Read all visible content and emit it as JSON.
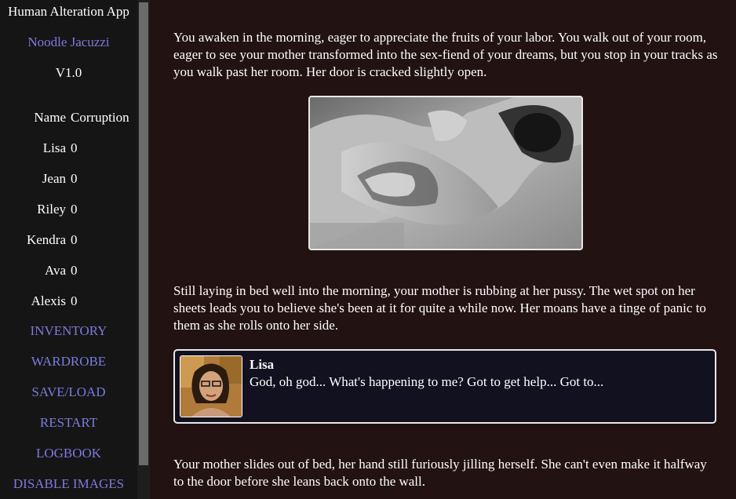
{
  "sidebar": {
    "app_title": "Human Alteration App",
    "author": "Noodle Jacuzzi",
    "version": "V1.0",
    "table_header": {
      "name": "Name",
      "corruption": "Corruption"
    },
    "characters": [
      {
        "name": "Lisa",
        "corruption": "0"
      },
      {
        "name": "Jean",
        "corruption": "0"
      },
      {
        "name": "Riley",
        "corruption": "0"
      },
      {
        "name": "Kendra",
        "corruption": "0"
      },
      {
        "name": "Ava",
        "corruption": "0"
      },
      {
        "name": "Alexis",
        "corruption": "0"
      }
    ],
    "menu": {
      "inventory": "INVENTORY",
      "wardrobe": "WARDROBE",
      "save_load": "SAVE/LOAD",
      "restart": "RESTART",
      "logbook": "LOGBOOK",
      "disable_images": "DISABLE IMAGES"
    }
  },
  "story": {
    "paragraph_1": "You awaken in the morning, eager to appreciate the fruits of your labor. You walk out of your room, eager to see your mother transformed into the sex-fiend of your dreams, but you stop in your tracks as you walk past her room. Her door is cracked slightly open.",
    "paragraph_2": "Still laying in bed well into the morning, your mother is rubbing at her pussy. The wet spot on her sheets leads you to believe she's been at it for quite a while now. Her moans have a tinge of panic to them as she rolls onto her side.",
    "dialog": {
      "speaker": "Lisa",
      "text": "God, oh god... What's happening to me? Got to get help... Got to..."
    },
    "paragraph_3": "Your mother slides out of bed, her hand still furiously jilling herself. She can't even make it halfway to the door before she leans back onto the wall."
  },
  "colors": {
    "sidebar_bg": "#151515",
    "main_bg": "#221212",
    "link": "#7b7bdf",
    "dialog_bg": "#12111f"
  }
}
